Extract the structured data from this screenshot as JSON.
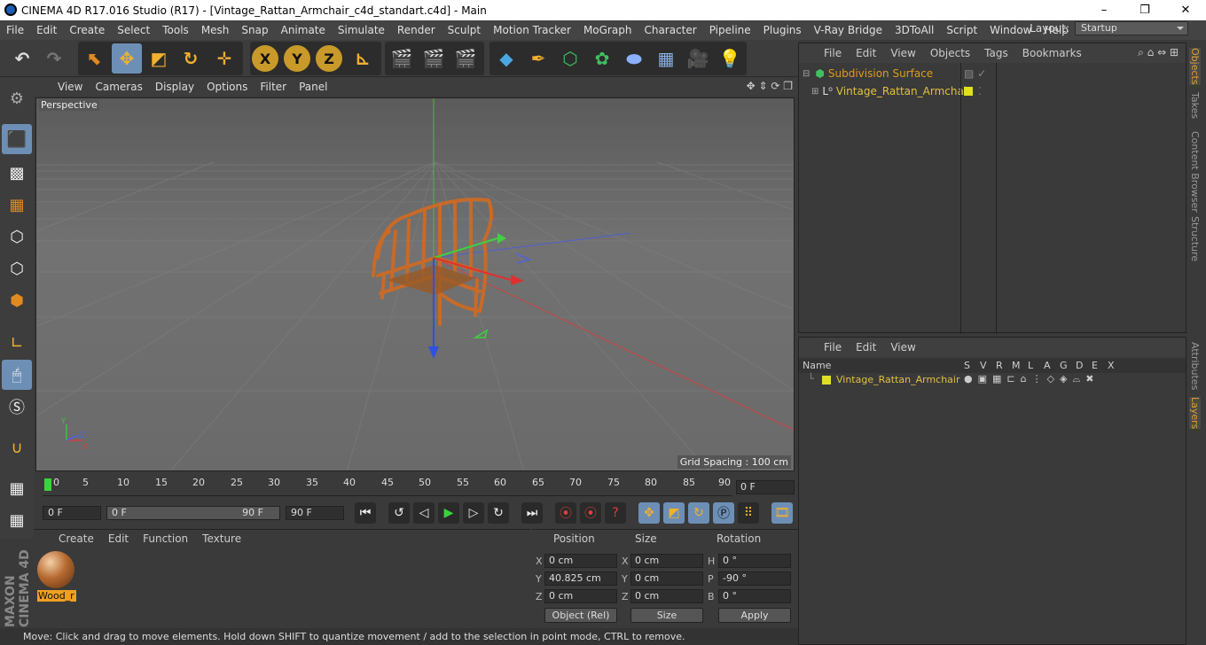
{
  "window": {
    "title": "CINEMA 4D R17.016 Studio (R17) - [Vintage_Rattan_Armchair_c4d_standart.c4d] - Main",
    "minimize": "–",
    "maximize": "❐",
    "close": "✕"
  },
  "menubar": [
    "File",
    "Edit",
    "Create",
    "Select",
    "Tools",
    "Mesh",
    "Snap",
    "Animate",
    "Simulate",
    "Render",
    "Sculpt",
    "Motion Tracker",
    "MoGraph",
    "Character",
    "Pipeline",
    "Plugins",
    "V-Ray Bridge",
    "3DToAll",
    "Script",
    "Window",
    "Help"
  ],
  "layout": {
    "label": "Layout:",
    "value": "Startup"
  },
  "toolbar": {
    "x_label": "X",
    "y_label": "Y",
    "z_label": "Z"
  },
  "viewport": {
    "menu": [
      "View",
      "Cameras",
      "Display",
      "Options",
      "Filter",
      "Panel"
    ],
    "camera": "Perspective",
    "grid_spacing": "Grid Spacing : 100 cm",
    "axis_x": "X",
    "axis_y": "Y",
    "axis_z": "Z"
  },
  "timeline": {
    "ticks": [
      "0",
      "5",
      "10",
      "15",
      "20",
      "25",
      "30",
      "35",
      "40",
      "45",
      "50",
      "55",
      "60",
      "65",
      "70",
      "75",
      "80",
      "85",
      "90"
    ],
    "current_frame": "0 F",
    "start_frame": "0 F",
    "range_start": "0 F",
    "range_end": "90 F",
    "end_frame": "90 F"
  },
  "material_panel": {
    "menu": [
      "Create",
      "Edit",
      "Function",
      "Texture"
    ],
    "material_name": "Wood_r"
  },
  "coord_panel": {
    "headers": {
      "position": "Position",
      "size": "Size",
      "rotation": "Rotation"
    },
    "pos": {
      "x": "0 cm",
      "y": "40.825 cm",
      "z": "0 cm"
    },
    "size": {
      "x": "0 cm",
      "y": "0 cm",
      "z": "0 cm"
    },
    "rot": {
      "h": "0 °",
      "p": "-90 °",
      "b": "0 °"
    },
    "labels": {
      "x": "X",
      "y": "Y",
      "z": "Z",
      "h": "H",
      "p": "P",
      "b": "B"
    },
    "mode": "Object (Rel)",
    "size_mode": "Size",
    "apply": "Apply"
  },
  "status": "Move: Click and drag to move elements. Hold down SHIFT to quantize movement / add to the selection in point mode, CTRL to remove.",
  "objects_panel": {
    "menu": [
      "File",
      "Edit",
      "View",
      "Objects",
      "Tags",
      "Bookmarks"
    ],
    "items": [
      {
        "name": "Subdivision Surface",
        "color": "#e09a1b"
      },
      {
        "name": "Vintage_Rattan_Armchair",
        "color": "#e0c040"
      }
    ]
  },
  "layers_panel": {
    "menu": [
      "File",
      "Edit",
      "View"
    ],
    "columns": [
      "Name",
      "S",
      "V",
      "R",
      "M",
      "L",
      "A",
      "G",
      "D",
      "E",
      "X"
    ],
    "rows": [
      {
        "name": "Vintage_Rattan_Armchair",
        "color": "#e0c040"
      }
    ]
  },
  "side_tabs": [
    "Objects",
    "Takes",
    "Content Browser",
    "Structure",
    "Attributes",
    "Layers"
  ],
  "branding": "MAXON CINEMA 4D"
}
